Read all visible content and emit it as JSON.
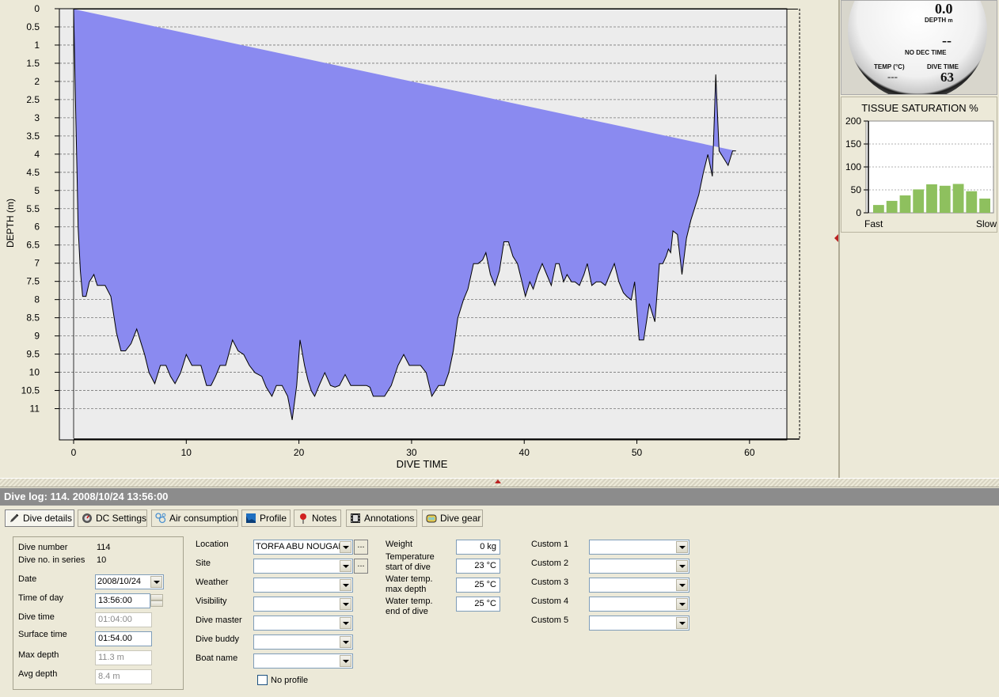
{
  "gauge": {
    "depth_value": "0.0",
    "depth_label": "DEPTH",
    "depth_unit": "m",
    "dec_value": "--",
    "dec_label": "NO DEC TIME",
    "temp_label": "TEMP (°C)",
    "temp_value": "---",
    "dive_time_label": "DIVE TIME",
    "dive_time_value": "63"
  },
  "tissue": {
    "title": "TISSUE SATURATION %",
    "fast_label": "Fast",
    "slow_label": "Slow",
    "y_ticks": [
      "200",
      "150",
      "100",
      "50",
      "0"
    ],
    "ylim": [
      0,
      200
    ],
    "bar_color": "#8ec05e",
    "values": [
      17,
      26,
      38,
      51,
      62,
      59,
      63,
      47,
      31
    ]
  },
  "chart_data": {
    "type": "area",
    "xlabel": "DIVE TIME",
    "ylabel": "DEPTH (m)",
    "xlim": [
      0,
      65
    ],
    "ylim": [
      0,
      11.5
    ],
    "y_inverted": true,
    "grid": "horizontal dashed",
    "fill_color": "#8a8af0",
    "x_ticks": [
      "0",
      "10",
      "20",
      "30",
      "40",
      "50",
      "60"
    ],
    "y_ticks": [
      "0",
      "0.5",
      "1",
      "1.5",
      "2",
      "2.5",
      "3",
      "3.5",
      "4",
      "4.5",
      "5",
      "5.5",
      "6",
      "6.5",
      "7",
      "7.5",
      "8",
      "8.5",
      "9",
      "9.5",
      "10",
      "10.5",
      "11"
    ],
    "profile_x": [
      0,
      0.1,
      0.2,
      0.3,
      0.4,
      0.6,
      0.8,
      1.1,
      1.4,
      1.8,
      2.1,
      2.4,
      2.8,
      3.3,
      3.8,
      4.2,
      4.6,
      5.1,
      5.6,
      6.0,
      6.3,
      6.7,
      7.2,
      7.7,
      8.2,
      8.6,
      9.0,
      9.5,
      10.0,
      10.5,
      10.9,
      11.3,
      11.8,
      12.2,
      12.6,
      13.0,
      13.5,
      14.1,
      14.6,
      15.1,
      15.6,
      16.1,
      16.7,
      17.1,
      17.6,
      18.0,
      18.5,
      19.0,
      19.4,
      19.8,
      20.1,
      20.5,
      20.8,
      21.1,
      21.4,
      21.8,
      22.3,
      22.8,
      23.2,
      23.6,
      24.1,
      24.6,
      25.0,
      25.5,
      26.0,
      26.3,
      26.6,
      27.1,
      27.6,
      28.2,
      28.8,
      29.3,
      29.8,
      30.3,
      30.8,
      31.3,
      31.8,
      32.4,
      32.9,
      33.3,
      33.7,
      34.1,
      34.6,
      35.0,
      35.5,
      35.9,
      36.3,
      36.6,
      37.0,
      37.4,
      37.8,
      38.2,
      38.6,
      39.0,
      39.4,
      39.8,
      40.1,
      40.5,
      40.8,
      41.2,
      41.6,
      42.0,
      42.4,
      42.8,
      43.1,
      43.5,
      43.8,
      44.2,
      44.5,
      44.9,
      45.3,
      45.6,
      46.0,
      46.4,
      46.8,
      47.2,
      47.6,
      48.0,
      48.4,
      48.8,
      49.1,
      49.5,
      49.8,
      50.2,
      50.6,
      51.1,
      51.6,
      52.0,
      52.3,
      52.6,
      52.8,
      53.0,
      53.2,
      53.6,
      54.0,
      54.4,
      54.8,
      55.1,
      55.5,
      55.9,
      56.3,
      56.7,
      57.0,
      57.3,
      57.7,
      58.1,
      58.5,
      58.8,
      59.3,
      59.8,
      60.2,
      60.6,
      60.9,
      61.2,
      61.4,
      61.6,
      61.8,
      62.1,
      62.4,
      62.7,
      63.0,
      63.3,
      63.6
    ],
    "profile_y": [
      0,
      1.5,
      3.0,
      4.5,
      6.0,
      7.2,
      7.9,
      7.9,
      7.5,
      7.3,
      7.6,
      7.6,
      7.6,
      7.9,
      8.9,
      9.4,
      9.4,
      9.2,
      8.8,
      9.2,
      9.5,
      10.0,
      10.3,
      9.8,
      9.8,
      10.1,
      10.3,
      10.0,
      9.5,
      9.8,
      9.8,
      9.8,
      10.35,
      10.35,
      10.1,
      9.8,
      9.8,
      9.1,
      9.4,
      9.5,
      9.8,
      10.0,
      10.1,
      10.4,
      10.65,
      10.35,
      10.35,
      10.65,
      11.3,
      10.35,
      9.1,
      9.8,
      10.2,
      10.5,
      10.65,
      10.35,
      10.0,
      10.35,
      10.4,
      10.35,
      10.05,
      10.35,
      10.35,
      10.35,
      10.35,
      10.4,
      10.65,
      10.65,
      10.65,
      10.35,
      9.8,
      9.5,
      9.8,
      9.8,
      9.8,
      10.0,
      10.65,
      10.35,
      10.35,
      10.0,
      9.4,
      8.5,
      8.0,
      7.7,
      7.0,
      7.0,
      6.9,
      6.7,
      7.3,
      7.6,
      7.2,
      6.4,
      6.4,
      6.8,
      7.0,
      7.5,
      7.9,
      7.5,
      7.7,
      7.3,
      7.0,
      7.3,
      7.6,
      7.0,
      7.0,
      7.5,
      7.3,
      7.5,
      7.5,
      7.6,
      7.3,
      7.0,
      7.6,
      7.5,
      7.5,
      7.6,
      7.3,
      7.0,
      7.5,
      7.8,
      7.9,
      8.0,
      7.5,
      9.1,
      9.1,
      8.1,
      8.6,
      7.0,
      7.0,
      6.8,
      6.6,
      6.7,
      6.1,
      6.2,
      7.3,
      6.3,
      5.8,
      5.5,
      5.1,
      4.5,
      4.0,
      4.6,
      1.8,
      3.9,
      4.1,
      4.3,
      3.9,
      3.9
    ]
  },
  "log_header": "Dive log: 114. 2008/10/24 13:56:00",
  "tabs": [
    "Dive details",
    "DC Settings",
    "Air consumption",
    "Profile",
    "Notes",
    "Annotations",
    "Dive gear"
  ],
  "details": {
    "dive_number_label": "Dive number",
    "dive_number": "114",
    "series_label": "Dive no. in series",
    "series": "10",
    "date_label": "Date",
    "date": "2008/10/24",
    "time_label": "Time of day",
    "time": "13:56:00",
    "dive_time_label": "Dive time",
    "dive_time": "01:04:00",
    "surface_label": "Surface time",
    "surface": "01:54.00",
    "max_depth_label": "Max depth",
    "max_depth": "11.3 m",
    "avg_depth_label": "Avg depth",
    "avg_depth": "8.4 m"
  },
  "location": {
    "location_label": "Location",
    "location": "TORFA ABU NOUGAR",
    "site_label": "Site",
    "site": "",
    "weather_label": "Weather",
    "weather": "",
    "visibility_label": "Visibility",
    "visibility": "",
    "divemaster_label": "Dive master",
    "divemaster": "",
    "buddy_label": "Dive buddy",
    "buddy": "",
    "boat_label": "Boat name",
    "boat": "",
    "no_profile_label": "No profile",
    "dots": "..."
  },
  "conditions": {
    "weight_label": "Weight",
    "weight": "0 kg",
    "temp_start_label_1": "Temperature",
    "temp_start_label_2": "start of dive",
    "temp_start": "23 °C",
    "temp_max_label_1": "Water temp.",
    "temp_max_label_2": "max depth",
    "temp_max": "25 °C",
    "temp_end_label_1": "Water temp.",
    "temp_end_label_2": "end of dive",
    "temp_end": "25 °C"
  },
  "custom": {
    "c1_label": "Custom 1",
    "c2_label": "Custom 2",
    "c3_label": "Custom 3",
    "c4_label": "Custom 4",
    "c5_label": "Custom 5",
    "c1": "",
    "c2": "",
    "c3": "",
    "c4": "",
    "c5": ""
  }
}
